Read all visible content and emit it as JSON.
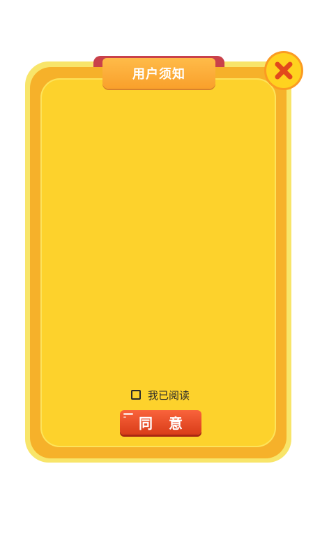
{
  "dialog": {
    "title": "用户须知",
    "agree_checkbox_label": "我已阅读",
    "agree_checked": false,
    "confirm_label": "同 意"
  },
  "icons": {
    "close": "close-x-icon"
  },
  "colors": {
    "panel_fill": "#fdd22c",
    "panel_border": "#f6b12a",
    "title_tab": "#f9a02b",
    "confirm_button": "#e3461f",
    "close_x": "#e2491c"
  }
}
